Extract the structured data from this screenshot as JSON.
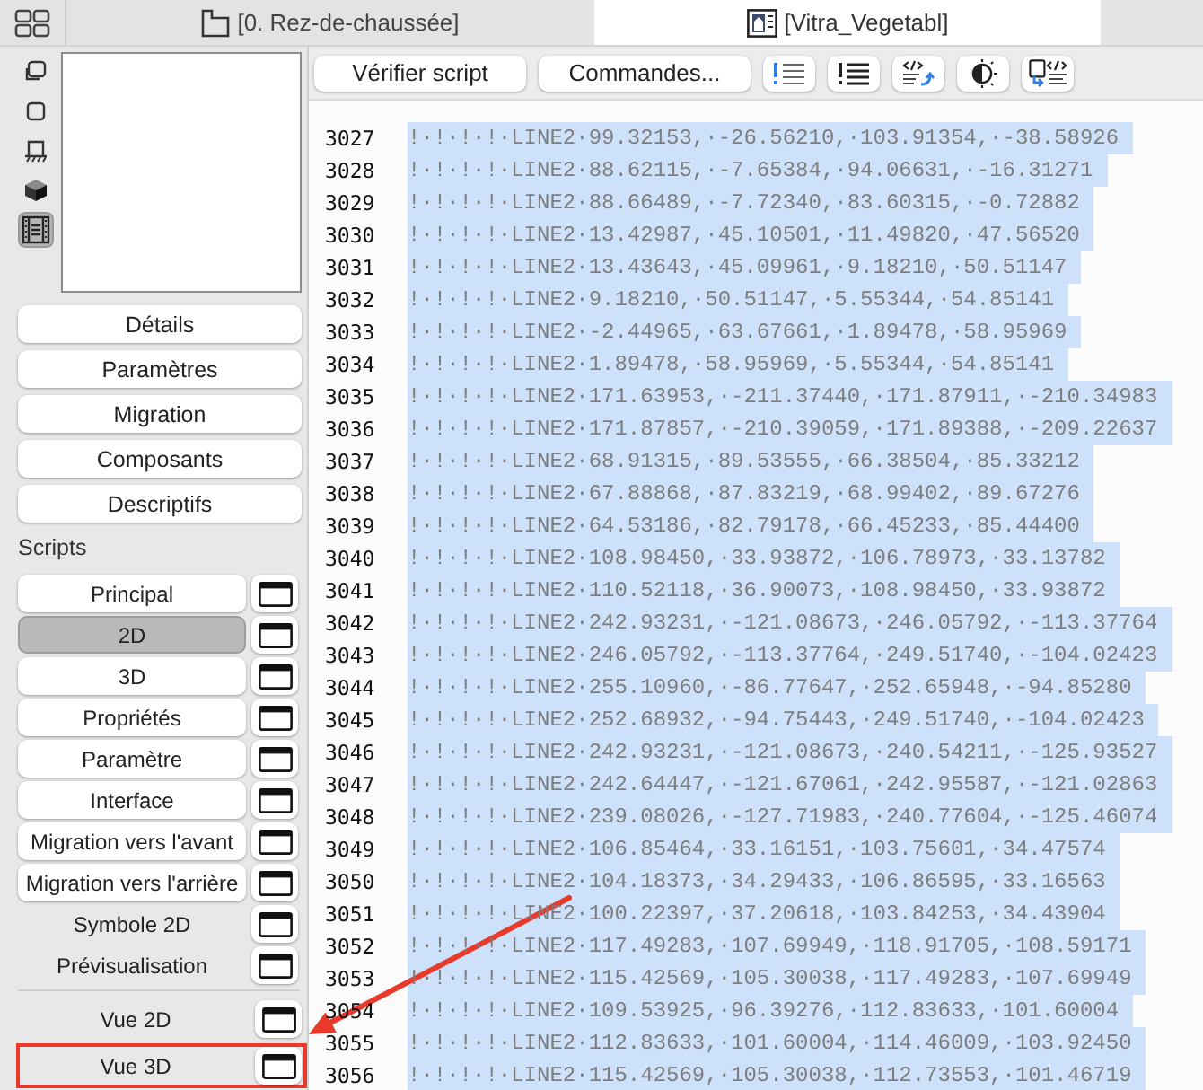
{
  "tabs": [
    {
      "label": "[0. Rez-de-chaussée]",
      "selected": false
    },
    {
      "label": "[Vitra_Vegetabl]",
      "selected": true
    }
  ],
  "view_modes": [
    {
      "selected": false
    },
    {
      "selected": false
    },
    {
      "selected": false
    },
    {
      "selected": false
    },
    {
      "selected": true
    }
  ],
  "sections": [
    "Détails",
    "Paramètres",
    "Migration",
    "Composants",
    "Descriptifs"
  ],
  "scripts": {
    "label": "Scripts",
    "items": [
      {
        "label": "Principal",
        "has_script": true,
        "selected": false
      },
      {
        "label": "2D",
        "has_script": true,
        "selected": true
      },
      {
        "label": "3D",
        "has_script": true,
        "selected": false
      },
      {
        "label": "Propriétés",
        "has_script": true,
        "selected": false
      },
      {
        "label": "Paramètre",
        "has_script": true,
        "selected": false
      },
      {
        "label": "Interface",
        "has_script": true,
        "selected": false
      },
      {
        "label": "Migration vers l'avant",
        "has_script": true,
        "selected": false
      },
      {
        "label": "Migration vers l'arrière",
        "has_script": true,
        "selected": false
      },
      {
        "label": "Symbole 2D",
        "has_script": false,
        "selected": false
      },
      {
        "label": "Prévisualisation",
        "has_script": false,
        "selected": false
      }
    ]
  },
  "views": [
    {
      "label": "Vue 2D",
      "has_script": false,
      "selected": false,
      "highlighted": false
    },
    {
      "label": "Vue 3D",
      "has_script": false,
      "selected": false,
      "highlighted": true
    }
  ],
  "toolbar": {
    "buttons": [
      "Vérifier script",
      "Commandes..."
    ]
  },
  "code": {
    "lines": [
      {
        "number": "3027",
        "text": "!·!·!·!·LINE2·99.32153,·-26.56210,·103.91354,·-38.58926",
        "selected": true
      },
      {
        "number": "3028",
        "text": "!·!·!·!·LINE2·88.62115,·-7.65384,·94.06631,·-16.31271",
        "selected": true
      },
      {
        "number": "3029",
        "text": "!·!·!·!·LINE2·88.66489,·-7.72340,·83.60315,·-0.72882",
        "selected": true
      },
      {
        "number": "3030",
        "text": "!·!·!·!·LINE2·13.42987,·45.10501,·11.49820,·47.56520",
        "selected": true
      },
      {
        "number": "3031",
        "text": "!·!·!·!·LINE2·13.43643,·45.09961,·9.18210,·50.51147",
        "selected": true
      },
      {
        "number": "3032",
        "text": "!·!·!·!·LINE2·9.18210,·50.51147,·5.55344,·54.85141",
        "selected": true
      },
      {
        "number": "3033",
        "text": "!·!·!·!·LINE2·-2.44965,·63.67661,·1.89478,·58.95969",
        "selected": true
      },
      {
        "number": "3034",
        "text": "!·!·!·!·LINE2·1.89478,·58.95969,·5.55344,·54.85141",
        "selected": true
      },
      {
        "number": "3035",
        "text": "!·!·!·!·LINE2·171.63953,·-211.37440,·171.87911,·-210.34983",
        "selected": true
      },
      {
        "number": "3036",
        "text": "!·!·!·!·LINE2·171.87857,·-210.39059,·171.89388,·-209.22637",
        "selected": true
      },
      {
        "number": "3037",
        "text": "!·!·!·!·LINE2·68.91315,·89.53555,·66.38504,·85.33212",
        "selected": true
      },
      {
        "number": "3038",
        "text": "!·!·!·!·LINE2·67.88868,·87.83219,·68.99402,·89.67276",
        "selected": true
      },
      {
        "number": "3039",
        "text": "!·!·!·!·LINE2·64.53186,·82.79178,·66.45233,·85.44400",
        "selected": true
      },
      {
        "number": "3040",
        "text": "!·!·!·!·LINE2·108.98450,·33.93872,·106.78973,·33.13782",
        "selected": true
      },
      {
        "number": "3041",
        "text": "!·!·!·!·LINE2·110.52118,·36.90073,·108.98450,·33.93872",
        "selected": true
      },
      {
        "number": "3042",
        "text": "!·!·!·!·LINE2·242.93231,·-121.08673,·246.05792,·-113.37764",
        "selected": true
      },
      {
        "number": "3043",
        "text": "!·!·!·!·LINE2·246.05792,·-113.37764,·249.51740,·-104.02423",
        "selected": true
      },
      {
        "number": "3044",
        "text": "!·!·!·!·LINE2·255.10960,·-86.77647,·252.65948,·-94.85280",
        "selected": true
      },
      {
        "number": "3045",
        "text": "!·!·!·!·LINE2·252.68932,·-94.75443,·249.51740,·-104.02423",
        "selected": true
      },
      {
        "number": "3046",
        "text": "!·!·!·!·LINE2·242.93231,·-121.08673,·240.54211,·-125.93527",
        "selected": true
      },
      {
        "number": "3047",
        "text": "!·!·!·!·LINE2·242.64447,·-121.67061,·242.95587,·-121.02863",
        "selected": true
      },
      {
        "number": "3048",
        "text": "!·!·!·!·LINE2·239.08026,·-127.71983,·240.77604,·-125.46074",
        "selected": true
      },
      {
        "number": "3049",
        "text": "!·!·!·!·LINE2·106.85464,·33.16151,·103.75601,·34.47574",
        "selected": true
      },
      {
        "number": "3050",
        "text": "!·!·!·!·LINE2·104.18373,·34.29433,·106.86595,·33.16563",
        "selected": true
      },
      {
        "number": "3051",
        "text": "!·!·!·!·LINE2·100.22397,·37.20618,·103.84253,·34.43904",
        "selected": true
      },
      {
        "number": "3052",
        "text": "!·!·!·!·LINE2·117.49283,·107.69949,·118.91705,·108.59171",
        "selected": true
      },
      {
        "number": "3053",
        "text": "!·!·!·!·LINE2·115.42569,·105.30038,·117.49283,·107.69949",
        "selected": true
      },
      {
        "number": "3054",
        "text": "!·!·!·!·LINE2·109.53925,·96.39276,·112.83633,·101.60004",
        "selected": true
      },
      {
        "number": "3055",
        "text": "!·!·!·!·LINE2·112.83633,·101.60004,·114.46009,·103.92450",
        "selected": true
      },
      {
        "number": "3056",
        "text": "!·!·!·!·LINE2·115.42569,·105.30038,·112.73553,·101.46719",
        "selected": true
      }
    ]
  },
  "annotation": {
    "kind": "arrow"
  }
}
